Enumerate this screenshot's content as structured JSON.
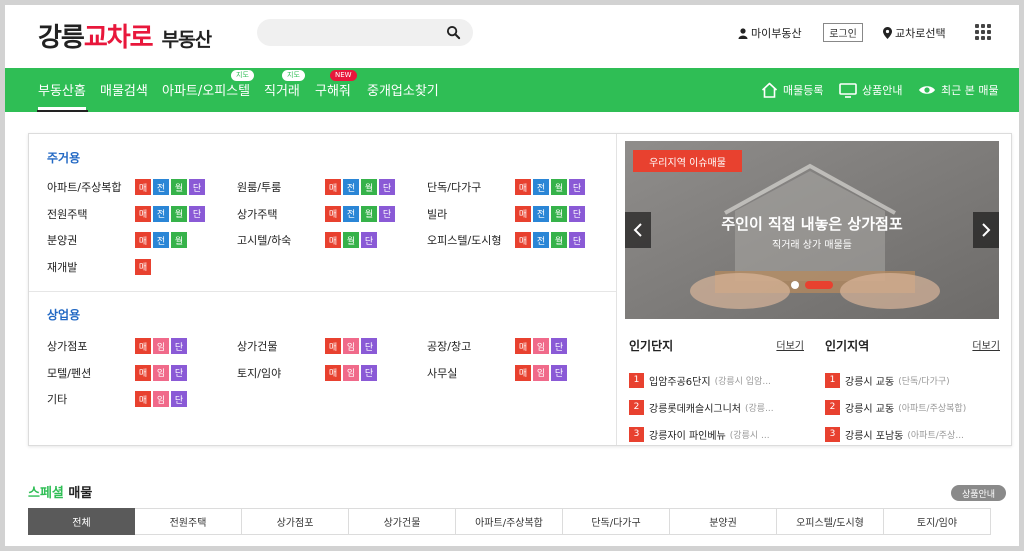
{
  "logo": {
    "part1": "강릉",
    "part2": "교차로",
    "part3": "부동산"
  },
  "search": {
    "placeholder": ""
  },
  "util": {
    "mypage": "마이부동산",
    "login": "로그인",
    "region": "교차로선택"
  },
  "nav": {
    "items": [
      {
        "label": "부동산홈"
      },
      {
        "label": "매물검색"
      },
      {
        "label": "아파트/오피스텔",
        "badge": "지도"
      },
      {
        "label": "직거래",
        "badge": "지도"
      },
      {
        "label": "구해줘",
        "badge": "NEW"
      },
      {
        "label": "중개업소찾기"
      }
    ],
    "right": {
      "register": "매물등록",
      "product": "상품안내",
      "recent": "최근 본 매물"
    }
  },
  "residential": {
    "title": "주거용",
    "rows": [
      {
        "label": "아파트/주상복합",
        "tags": [
          "매",
          "전",
          "월",
          "단"
        ]
      },
      {
        "label": "원룸/투룸",
        "tags": [
          "매",
          "전",
          "월",
          "단"
        ]
      },
      {
        "label": "단독/다가구",
        "tags": [
          "매",
          "전",
          "월",
          "단"
        ]
      },
      {
        "label": "전원주택",
        "tags": [
          "매",
          "전",
          "월",
          "단"
        ]
      },
      {
        "label": "상가주택",
        "tags": [
          "매",
          "전",
          "월",
          "단"
        ]
      },
      {
        "label": "빌라",
        "tags": [
          "매",
          "전",
          "월",
          "단"
        ]
      },
      {
        "label": "분양권",
        "tags": [
          "매",
          "전",
          "월"
        ]
      },
      {
        "label": "고시텔/하숙",
        "tags": [
          "매",
          "월",
          "단"
        ]
      },
      {
        "label": "오피스텔/도시형",
        "tags": [
          "매",
          "전",
          "월",
          "단"
        ]
      },
      {
        "label": "재개발",
        "tags": [
          "매"
        ]
      }
    ]
  },
  "commercial": {
    "title": "상업용",
    "rows": [
      {
        "label": "상가점포",
        "tags": [
          "매",
          "임",
          "단"
        ]
      },
      {
        "label": "상가건물",
        "tags": [
          "매",
          "임",
          "단"
        ]
      },
      {
        "label": "공장/창고",
        "tags": [
          "매",
          "임",
          "단"
        ]
      },
      {
        "label": "모텔/펜션",
        "tags": [
          "매",
          "임",
          "단"
        ]
      },
      {
        "label": "토지/임야",
        "tags": [
          "매",
          "임",
          "단"
        ]
      },
      {
        "label": "사무실",
        "tags": [
          "매",
          "임",
          "단"
        ]
      },
      {
        "label": "기타",
        "tags": [
          "매",
          "임",
          "단"
        ]
      }
    ]
  },
  "banner": {
    "pill": "우리지역 이슈매물",
    "headline": "주인이 직접 내놓은 상가점포",
    "subline": "직거래 상가 매물들"
  },
  "popular_complex": {
    "title": "인기단지",
    "more": "더보기",
    "items": [
      {
        "rank": "1",
        "name": "입암주공6단지",
        "sub": "(강릉시 입암..."
      },
      {
        "rank": "2",
        "name": "강릉롯데캐슬시그니처",
        "sub": "(강릉..."
      },
      {
        "rank": "3",
        "name": "강릉자이 파인베뉴",
        "sub": "(강릉시 ..."
      }
    ]
  },
  "popular_region": {
    "title": "인기지역",
    "more": "더보기",
    "items": [
      {
        "rank": "1",
        "name": "강릉시 교동",
        "sub": "(단독/다가구)"
      },
      {
        "rank": "2",
        "name": "강릉시 교동",
        "sub": "(아파트/주상복합)"
      },
      {
        "rank": "3",
        "name": "강릉시 포남동",
        "sub": "(아파트/주상..."
      }
    ]
  },
  "special": {
    "title_green": "스페셜",
    "title_dark": "매물",
    "button": "상품안내",
    "tabs": [
      "전체",
      "전원주택",
      "상가점포",
      "상가건물",
      "아파트/주상복합",
      "단독/다가구",
      "분양권",
      "오피스텔/도시형",
      "토지/임야"
    ]
  },
  "colors": {
    "brand_green": "#2fbe55",
    "brand_red": "#e8173b",
    "tag_sale": "#e8412f",
    "tag_jeonse": "#2b86d6",
    "tag_monthly": "#36b24a",
    "tag_short": "#8a5ad6",
    "tag_lease": "#f06a8a"
  }
}
